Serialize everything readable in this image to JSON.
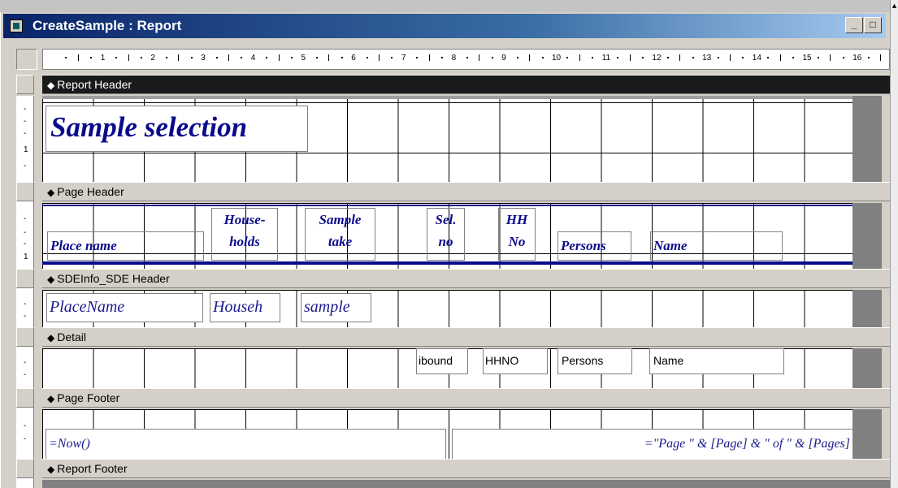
{
  "window": {
    "title": "CreateSample : Report",
    "minimize_label": "_",
    "maximize_label": "□"
  },
  "ruler": {
    "numbers": [
      "1",
      "2",
      "3",
      "4",
      "5",
      "6",
      "7",
      "8",
      "9",
      "10",
      "11",
      "12",
      "13",
      "14",
      "15",
      "16"
    ]
  },
  "vruler": {
    "labels": [
      "1",
      "1"
    ]
  },
  "sections": {
    "report_header": "Report Header",
    "page_header": "Page Header",
    "group_header": "SDEInfo_SDE Header",
    "detail": "Detail",
    "page_footer": "Page Footer",
    "report_footer": "Report Footer"
  },
  "report_header": {
    "title": "Sample selection"
  },
  "page_header": {
    "place_name": "Place name",
    "households": "House-\nholds",
    "sample_take": "Sample\ntake",
    "sel_no": "Sel.\nno",
    "hh_no": "HH\nNo",
    "persons": "Persons",
    "name": "Name"
  },
  "group_header": {
    "place_name": "PlaceName",
    "households": "Househ",
    "sample": "sample"
  },
  "detail": {
    "unbound": "ibound",
    "hhno": "HHNO",
    "persons": "Persons",
    "name": "Name"
  },
  "page_footer": {
    "now": "=Now()",
    "page_expr": "=\"Page \" & [Page] & \" of \" & [Pages]"
  }
}
